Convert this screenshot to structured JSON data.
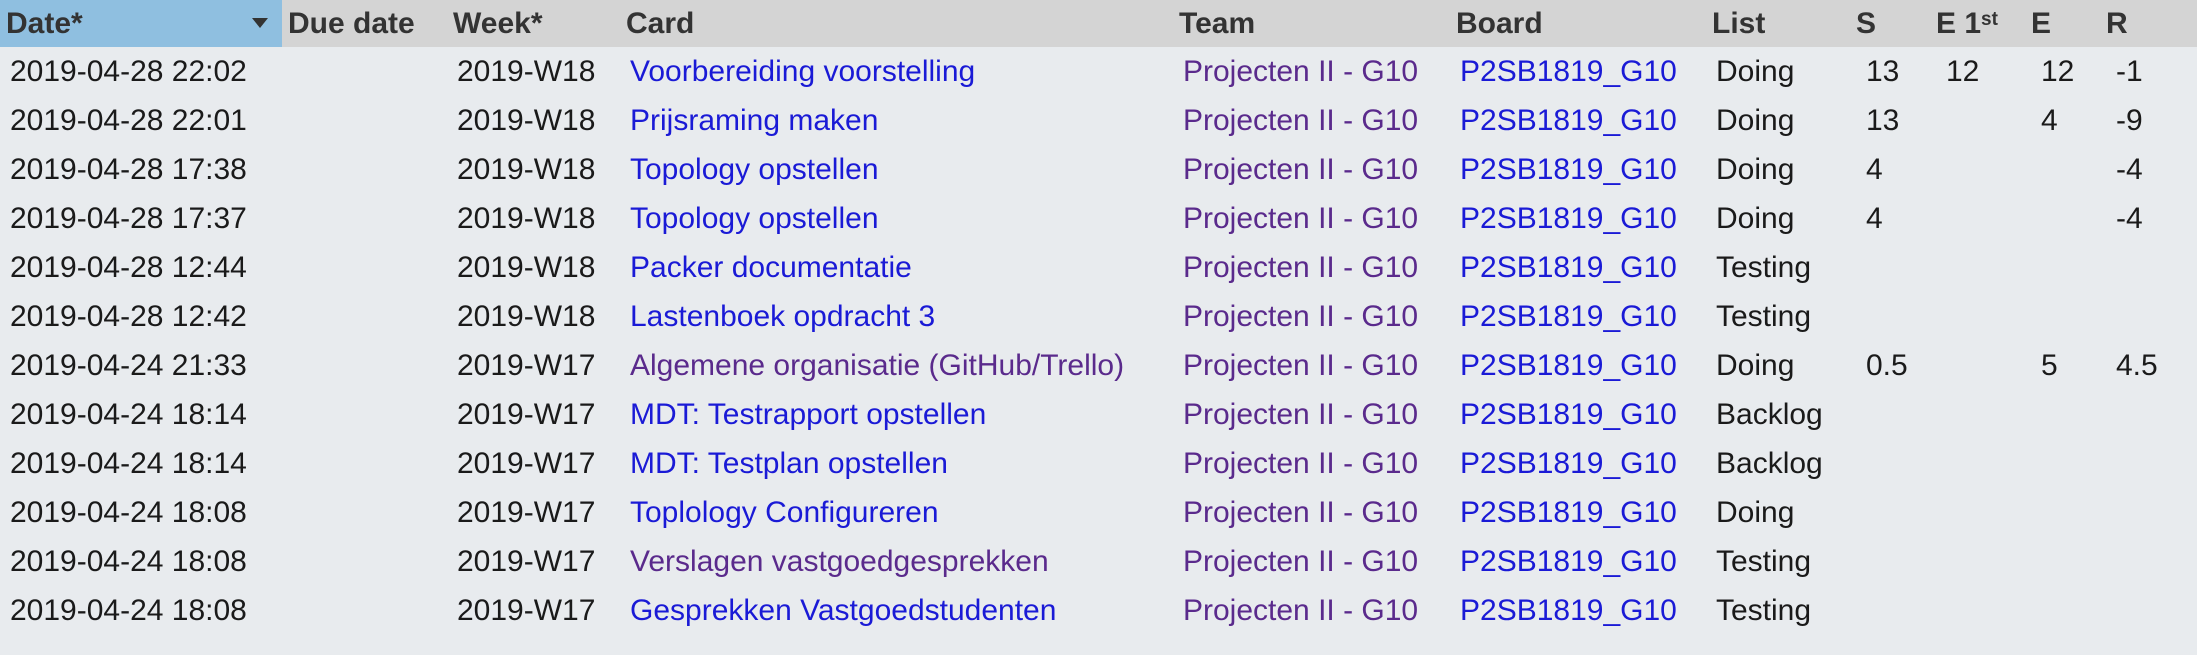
{
  "columns": [
    {
      "key": "date",
      "label": "Date*",
      "sorted": true
    },
    {
      "key": "due",
      "label": "Due date"
    },
    {
      "key": "week",
      "label": "Week*"
    },
    {
      "key": "card",
      "label": "Card"
    },
    {
      "key": "team",
      "label": "Team"
    },
    {
      "key": "board",
      "label": "Board"
    },
    {
      "key": "list",
      "label": "List"
    },
    {
      "key": "s",
      "label": "S"
    },
    {
      "key": "e1",
      "label": "E 1",
      "sup": "st"
    },
    {
      "key": "e",
      "label": "E"
    },
    {
      "key": "r",
      "label": "R"
    }
  ],
  "colors": {
    "link": "#1a1ad6",
    "visited_link": "#5a2a8c",
    "header_bg": "#d4d4d4",
    "sorted_header_bg": "#8fbfe0",
    "body_bg": "#e8ebee"
  },
  "rows": [
    {
      "date": "2019-04-28 22:02",
      "due": "",
      "week": "2019-W18",
      "card": "Voorbereiding voorstelling",
      "card_visited": false,
      "team": "Projecten II - G10",
      "board": "P2SB1819_G10",
      "list": "Doing",
      "s": "13",
      "e1": "12",
      "e": "12",
      "r": "-1"
    },
    {
      "date": "2019-04-28 22:01",
      "due": "",
      "week": "2019-W18",
      "card": "Prijsraming maken",
      "card_visited": false,
      "team": "Projecten II - G10",
      "board": "P2SB1819_G10",
      "list": "Doing",
      "s": "13",
      "e1": "",
      "e": "4",
      "r": "-9"
    },
    {
      "date": "2019-04-28 17:38",
      "due": "",
      "week": "2019-W18",
      "card": "Topology opstellen",
      "card_visited": false,
      "team": "Projecten II - G10",
      "board": "P2SB1819_G10",
      "list": "Doing",
      "s": "4",
      "e1": "",
      "e": "",
      "r": "-4"
    },
    {
      "date": "2019-04-28 17:37",
      "due": "",
      "week": "2019-W18",
      "card": "Topology opstellen",
      "card_visited": false,
      "team": "Projecten II - G10",
      "board": "P2SB1819_G10",
      "list": "Doing",
      "s": "4",
      "e1": "",
      "e": "",
      "r": "-4"
    },
    {
      "date": "2019-04-28 12:44",
      "due": "",
      "week": "2019-W18",
      "card": "Packer documentatie",
      "card_visited": false,
      "team": "Projecten II - G10",
      "board": "P2SB1819_G10",
      "list": "Testing",
      "s": "",
      "e1": "",
      "e": "",
      "r": ""
    },
    {
      "date": "2019-04-28 12:42",
      "due": "",
      "week": "2019-W18",
      "card": "Lastenboek opdracht 3",
      "card_visited": false,
      "team": "Projecten II - G10",
      "board": "P2SB1819_G10",
      "list": "Testing",
      "s": "",
      "e1": "",
      "e": "",
      "r": ""
    },
    {
      "date": "2019-04-24 21:33",
      "due": "",
      "week": "2019-W17",
      "card": "Algemene organisatie (GitHub/Trello)",
      "card_visited": true,
      "team": "Projecten II - G10",
      "board": "P2SB1819_G10",
      "list": "Doing",
      "s": "0.5",
      "e1": "",
      "e": "5",
      "r": "4.5"
    },
    {
      "date": "2019-04-24 18:14",
      "due": "",
      "week": "2019-W17",
      "card": "MDT: Testrapport opstellen",
      "card_visited": false,
      "team": "Projecten II - G10",
      "board": "P2SB1819_G10",
      "list": "Backlog",
      "s": "",
      "e1": "",
      "e": "",
      "r": ""
    },
    {
      "date": "2019-04-24 18:14",
      "due": "",
      "week": "2019-W17",
      "card": "MDT: Testplan opstellen",
      "card_visited": false,
      "team": "Projecten II - G10",
      "board": "P2SB1819_G10",
      "list": "Backlog",
      "s": "",
      "e1": "",
      "e": "",
      "r": ""
    },
    {
      "date": "2019-04-24 18:08",
      "due": "",
      "week": "2019-W17",
      "card": "Toplology Configureren",
      "card_visited": false,
      "team": "Projecten II - G10",
      "board": "P2SB1819_G10",
      "list": "Doing",
      "s": "",
      "e1": "",
      "e": "",
      "r": ""
    },
    {
      "date": "2019-04-24 18:08",
      "due": "",
      "week": "2019-W17",
      "card": "Verslagen vastgoedgesprekken",
      "card_visited": true,
      "team": "Projecten II - G10",
      "board": "P2SB1819_G10",
      "list": "Testing",
      "s": "",
      "e1": "",
      "e": "",
      "r": ""
    },
    {
      "date": "2019-04-24 18:08",
      "due": "",
      "week": "2019-W17",
      "card": "Gesprekken Vastgoedstudenten",
      "card_visited": false,
      "team": "Projecten II - G10",
      "board": "P2SB1819_G10",
      "list": "Testing",
      "s": "",
      "e1": "",
      "e": "",
      "r": ""
    }
  ]
}
